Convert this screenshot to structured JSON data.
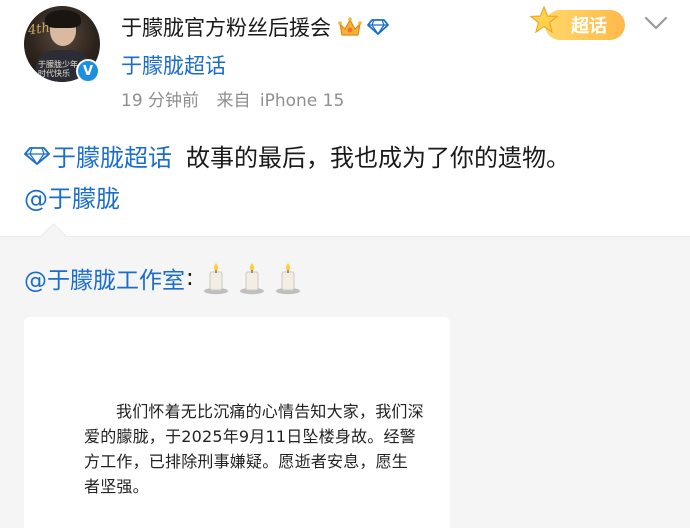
{
  "post": {
    "author_name": "于朦胧官方粉丝后援会",
    "chaohua_link": "于朦胧超话",
    "time": "19 分钟前",
    "source_prefix": "来自",
    "source_device": "iPhone 15",
    "chaohua_badge": "超话",
    "topic": "于朦胧超话",
    "content": "故事的最后，我也成为了你的遗物。",
    "mention": "@于朦胧"
  },
  "avatar": {
    "script": "4th",
    "caption_line1": "于朦胧少年",
    "caption_line2": "时代快乐"
  },
  "repost": {
    "mention": "@于朦胧工作室",
    "colon": ":",
    "emoji": [
      "candle-icon",
      "candle-icon",
      "candle-icon"
    ],
    "card_text": "我们怀着无比沉痛的心情告知大家，我们深爱的朦胧，于2025年9月11日坠楼身故。经警方工作，已排除刑事嫌疑。愿逝者安息，愿生者坚强。"
  },
  "colors": {
    "link_blue": "#1a6dcc",
    "meta_gray": "#8f8f8f",
    "verified_blue": "#1e8fe0",
    "badge_orange": "#ffb94a",
    "repost_bg": "#f5f5f5"
  }
}
